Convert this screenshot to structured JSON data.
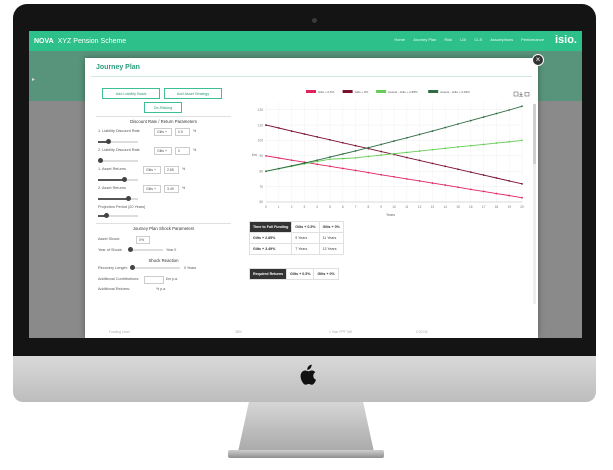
{
  "navbar": {
    "brand": "NOVA",
    "scheme": "XYZ Pension Scheme",
    "links": [
      "Home",
      "Journey Plan",
      "Risk",
      "LDI",
      "CLS",
      "Assumptions",
      "Performance"
    ],
    "logo": "isio."
  },
  "modal": {
    "title": "Journey Plan",
    "close_label": "×"
  },
  "left": {
    "buttons": {
      "add_liability": "Add Liability Basis",
      "add_asset": "Add Asset Strategy",
      "derisking": "De-Risking"
    },
    "discount_title": "Discount Rate / Return Parameters",
    "rows": [
      {
        "label": "1. Liability Discount Rate",
        "select": "Gilts +",
        "value": "0.5",
        "unit": "%"
      },
      {
        "label": "2. Liability Discount Rate",
        "select": "Gilts +",
        "value": "0",
        "unit": "%"
      },
      {
        "label": "1. Asset Returns",
        "select": "Gilts +",
        "value": "2.85",
        "unit": "%"
      },
      {
        "label": "2. Asset Returns",
        "select": "Gilts +",
        "value": "3.49",
        "unit": "%"
      }
    ],
    "projection_label": "Projection Period (20 Years)",
    "shock_title": "Journey Plan Shock Parameters",
    "asset_shock_label": "Asset Shock:",
    "asset_shock_value": "0%",
    "year_shock_label": "Year of Shock:",
    "year_shock_value": "Year 0",
    "shock_reaction_title": "Shock Reaction",
    "recovery_label": "Recovery Length:",
    "recovery_value": "0 Years",
    "contrib_label": "Additional Contributions:",
    "contrib_unit": "£m p.a.",
    "returns_label": "Additional Returns:",
    "returns_unit": "% p.a."
  },
  "chart_data": {
    "type": "line",
    "x": [
      0,
      1,
      2,
      3,
      4,
      5,
      6,
      7,
      8,
      9,
      10,
      11,
      12,
      13,
      14,
      15,
      16,
      17,
      18,
      19,
      20
    ],
    "xlabel": "Years",
    "ylabel": "£m",
    "yticks": [
      "120",
      "110",
      "100",
      "90",
      "80",
      "70",
      "60"
    ],
    "ylim": [
      60,
      125
    ],
    "series": [
      {
        "name": "Gilts + 0.5%",
        "color": "#e0245e",
        "values": [
          90.0,
          88.6,
          87.2,
          85.9,
          84.5,
          83.2,
          81.8,
          80.5,
          79.1,
          77.7,
          76.4,
          75.0,
          73.7,
          72.3,
          71.0,
          69.6,
          68.2,
          66.9,
          65.5,
          64.2,
          62.8
        ]
      },
      {
        "name": "Gilts + 0%",
        "color": "#7a0f2e",
        "values": [
          110.0,
          108.1,
          106.1,
          104.2,
          102.3,
          100.4,
          98.5,
          96.6,
          94.7,
          92.8,
          90.9,
          88.9,
          87.0,
          85.1,
          83.2,
          81.3,
          79.4,
          77.5,
          75.6,
          73.7,
          71.8
        ]
      },
      {
        "name": "Assets - Gilts + 2.85%",
        "color": "#66cc55",
        "values": [
          80.0,
          81.6,
          83.2,
          84.8,
          86.4,
          87.8,
          88.2,
          88.7,
          89.6,
          90.5,
          91.4,
          92.2,
          93.1,
          94.0,
          94.9,
          95.8,
          96.6,
          97.4,
          98.3,
          99.1,
          100.0
        ]
      },
      {
        "name": "Assets - Gilts + 3.49%",
        "color": "#2f6b43",
        "values": [
          80.0,
          81.7,
          83.5,
          85.3,
          87.2,
          89.2,
          91.2,
          93.2,
          95.3,
          97.4,
          99.6,
          101.7,
          103.9,
          106.1,
          108.4,
          110.7,
          112.9,
          115.2,
          117.5,
          119.8,
          122.2
        ]
      }
    ],
    "grid": true,
    "legend": "top"
  },
  "funding_table": {
    "headers": [
      "Time to Full Funding",
      "Gilts + 0.5%",
      "Gilts + 0%"
    ],
    "rows": [
      [
        "Gilts + 2.85%",
        "9 Years",
        "11 Years"
      ],
      [
        "Gilts + 3.49%",
        "7 Years",
        "13 Years"
      ]
    ]
  },
  "returns_table": {
    "headers": [
      "Required Returns",
      "Gilts + 0.5%",
      "Gilts + 0%"
    ]
  },
  "background_fragments": {
    "left": "Funding Level",
    "mid": "1 Year PPF Taff",
    "right": "0.00 NZ",
    "pct": "38%"
  },
  "toolbar_icons": [
    "menu-icon",
    "download-icon",
    "print-icon"
  ]
}
